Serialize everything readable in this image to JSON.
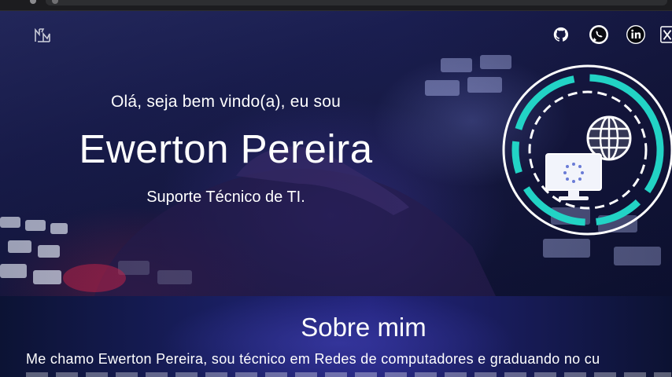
{
  "hero": {
    "greeting": "Olá, seja bem vindo(a), eu sou",
    "name": "Ewerton Pereira",
    "role": "Suporte Técnico de TI."
  },
  "header": {
    "logo": "site-logo-icon",
    "social": [
      {
        "icon": "github-icon"
      },
      {
        "icon": "whatsapp-icon"
      },
      {
        "icon": "linkedin-icon"
      },
      {
        "icon": "x-twitter-icon"
      }
    ]
  },
  "about": {
    "title": "Sobre mim",
    "text": "Me chamo Ewerton Pereira, sou técnico em Redes de computadores e graduando no cu"
  },
  "colors": {
    "accent": "#22d3c5",
    "text": "#ffffff",
    "hero_bg": "#1b1f52",
    "about_bg": "#1a1f63"
  }
}
